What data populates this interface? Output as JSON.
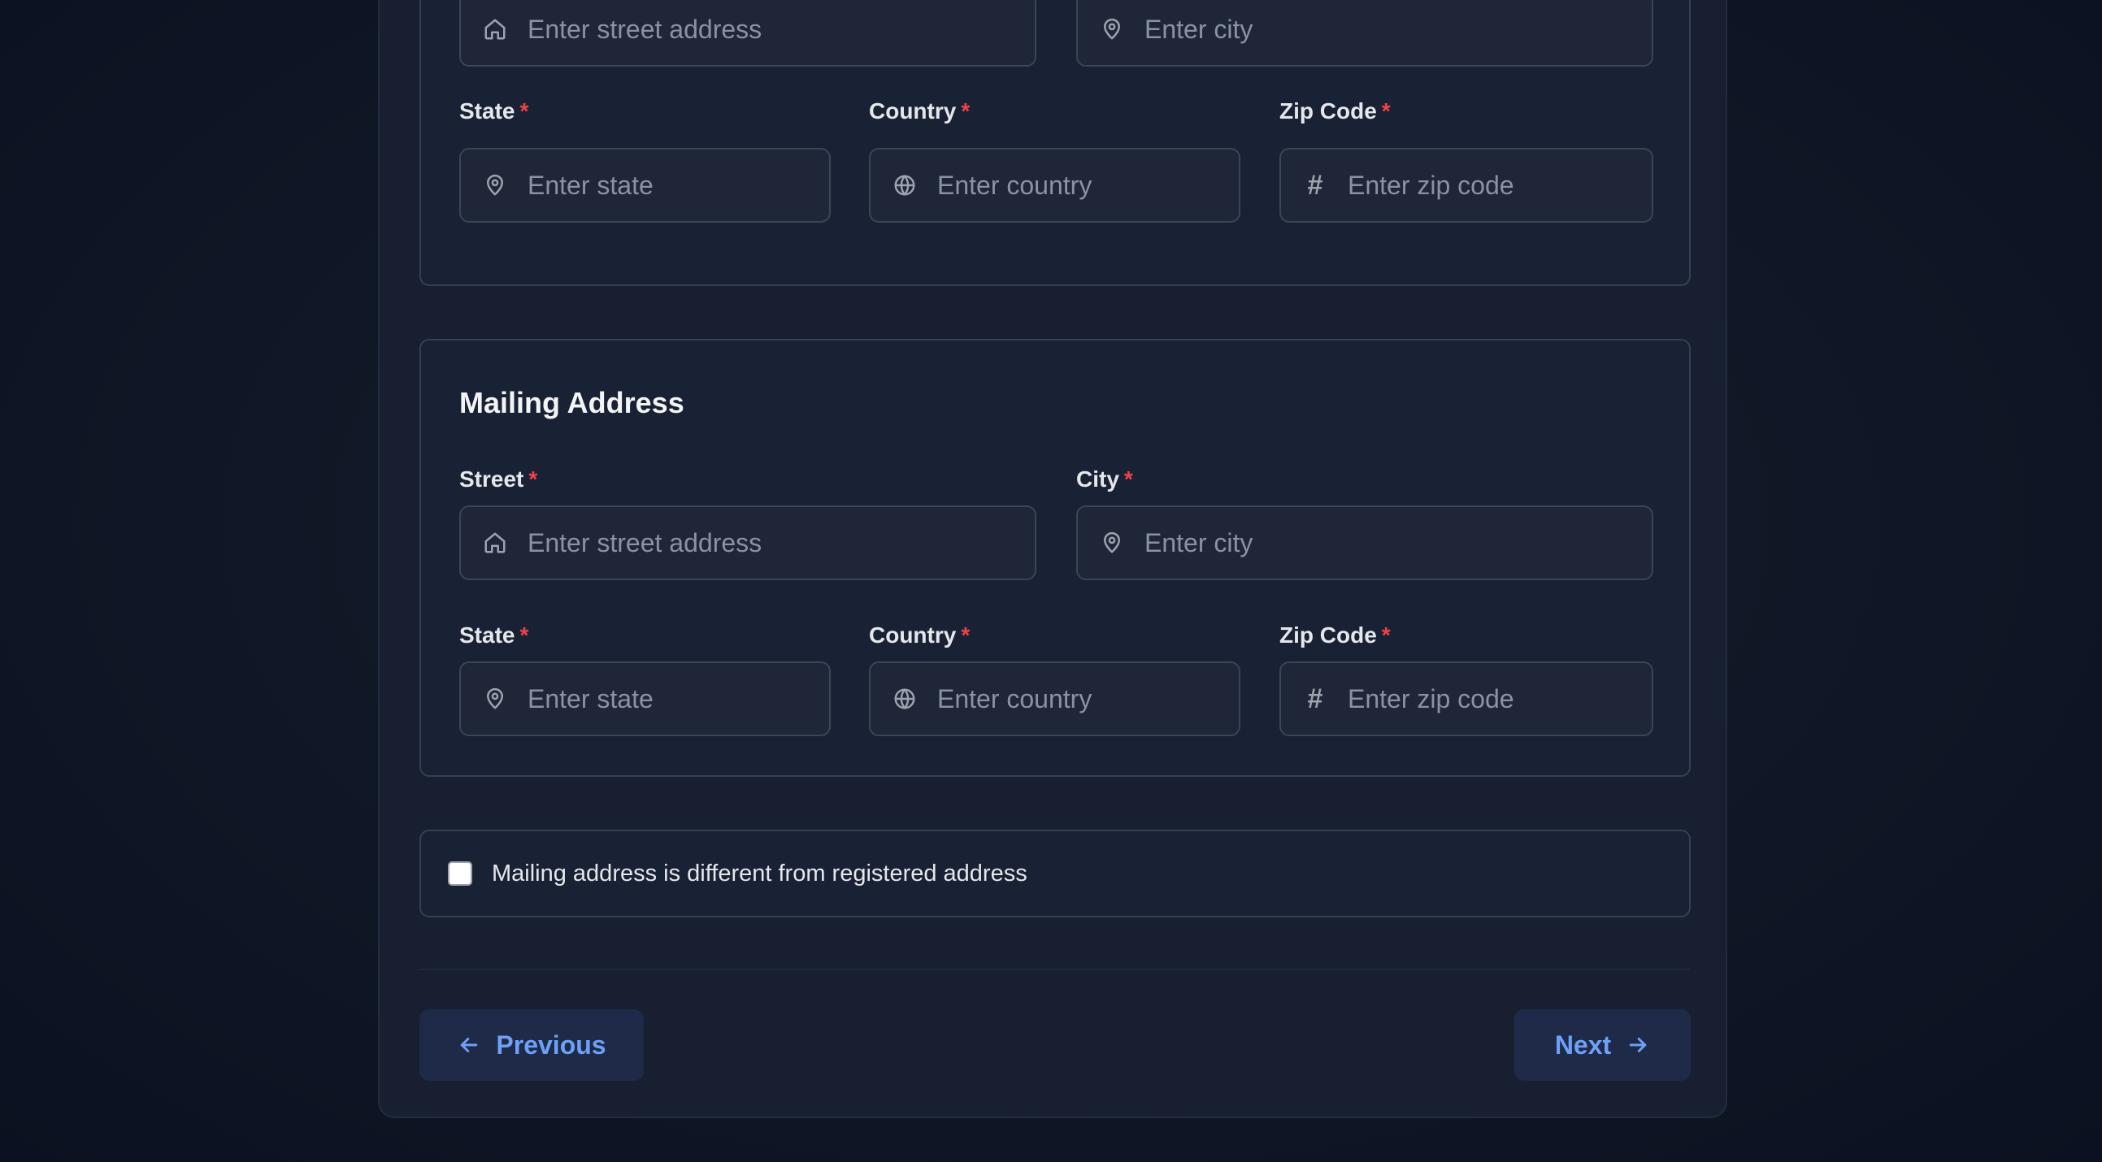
{
  "registered_address": {
    "street": {
      "placeholder": "Enter street address",
      "icon": "home-icon"
    },
    "city": {
      "placeholder": "Enter city",
      "icon": "map-pin-icon"
    },
    "state": {
      "label": "State",
      "placeholder": "Enter state",
      "icon": "map-pin-icon"
    },
    "country": {
      "label": "Country",
      "placeholder": "Enter country",
      "icon": "globe-icon"
    },
    "zip": {
      "label": "Zip Code",
      "placeholder": "Enter zip code",
      "icon": "hash-icon"
    }
  },
  "mailing_address": {
    "title": "Mailing Address",
    "street": {
      "label": "Street",
      "placeholder": "Enter street address",
      "icon": "home-icon"
    },
    "city": {
      "label": "City",
      "placeholder": "Enter city",
      "icon": "map-pin-icon"
    },
    "state": {
      "label": "State",
      "placeholder": "Enter state",
      "icon": "map-pin-icon"
    },
    "country": {
      "label": "Country",
      "placeholder": "Enter country",
      "icon": "globe-icon"
    },
    "zip": {
      "label": "Zip Code",
      "placeholder": "Enter zip code",
      "icon": "hash-icon"
    }
  },
  "required_marker": "*",
  "hash_glyph": "#",
  "different_mailing_checkbox": {
    "label": "Mailing address is different from registered address",
    "checked": false
  },
  "navigation": {
    "previous_label": "Previous",
    "next_label": "Next"
  },
  "colors": {
    "accent": "#6ea0f6",
    "required": "#ef4444",
    "background": "#111827"
  }
}
